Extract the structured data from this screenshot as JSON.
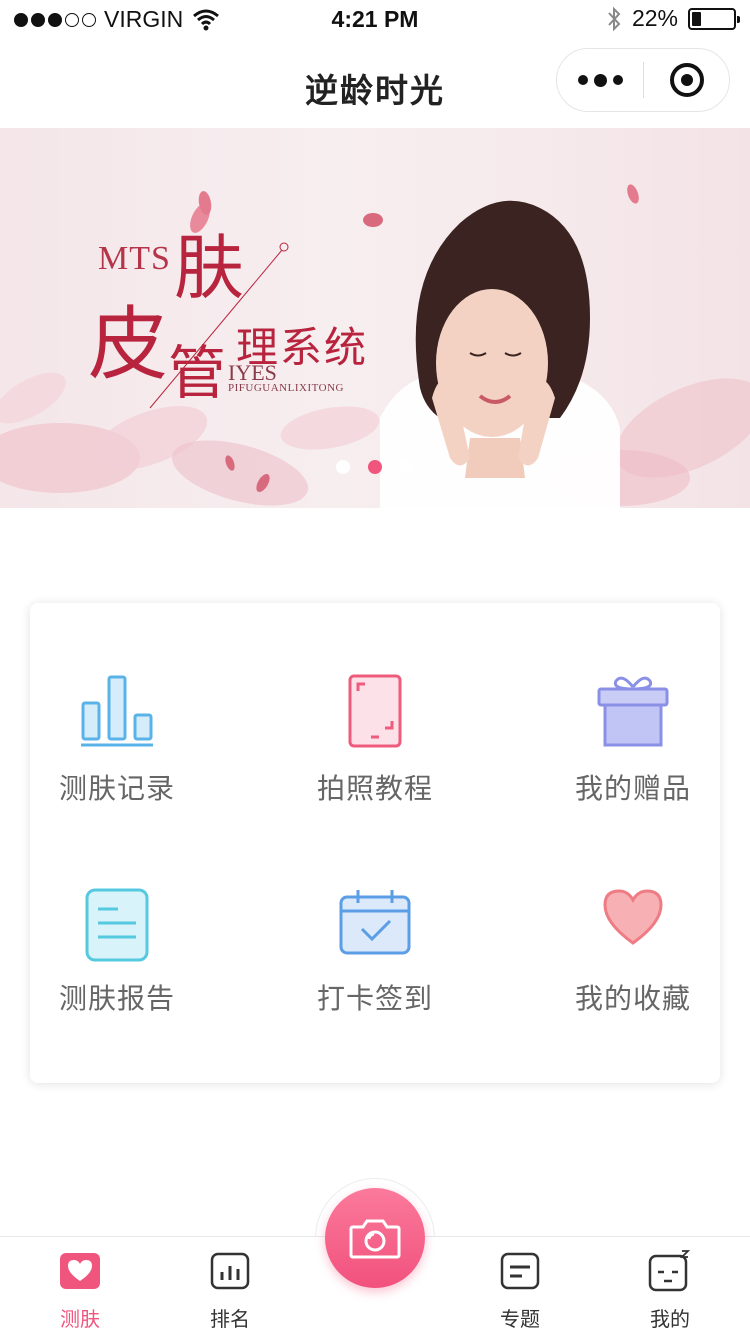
{
  "status_bar": {
    "carrier": "VIRGIN",
    "time": "4:21 PM",
    "battery_percent": "22%",
    "battery_level": 0.22
  },
  "nav": {
    "title": "逆龄时光",
    "capsule": {
      "more_icon": "more-dots-icon",
      "close_icon": "target-icon"
    }
  },
  "banner": {
    "mts": "MTS",
    "fu": "肤",
    "pi": "皮",
    "guan": "管",
    "lixitong": "理系统",
    "iyes": "IYES",
    "pinyin": "PIFUGUANLIXITONG",
    "page_count": 3,
    "active_page": 2
  },
  "grid": [
    {
      "label": "测肤记录",
      "icon": "bar-chart-icon",
      "color": "#5ab3e8"
    },
    {
      "label": "拍照教程",
      "icon": "tablet-icon",
      "color": "#ee5b7c"
    },
    {
      "label": "我的赠品",
      "icon": "gift-icon",
      "color": "#8a90e6"
    },
    {
      "label": "测肤报告",
      "icon": "document-icon",
      "color": "#54c9e0"
    },
    {
      "label": "打卡签到",
      "icon": "calendar-check-icon",
      "color": "#5b9ee6"
    },
    {
      "label": "我的收藏",
      "icon": "heart-icon",
      "color": "#ef7b84"
    }
  ],
  "tabs": [
    {
      "label": "测肤",
      "icon": "heart-tab-icon",
      "active": true
    },
    {
      "label": "排名",
      "icon": "ranking-icon",
      "active": false
    },
    {
      "label": "专题",
      "icon": "topic-icon",
      "active": false
    },
    {
      "label": "我的",
      "icon": "profile-face-icon",
      "active": false
    }
  ],
  "camera_icon": "camera-icon",
  "colors": {
    "accent": "#f0557e",
    "text_label": "#666666"
  }
}
